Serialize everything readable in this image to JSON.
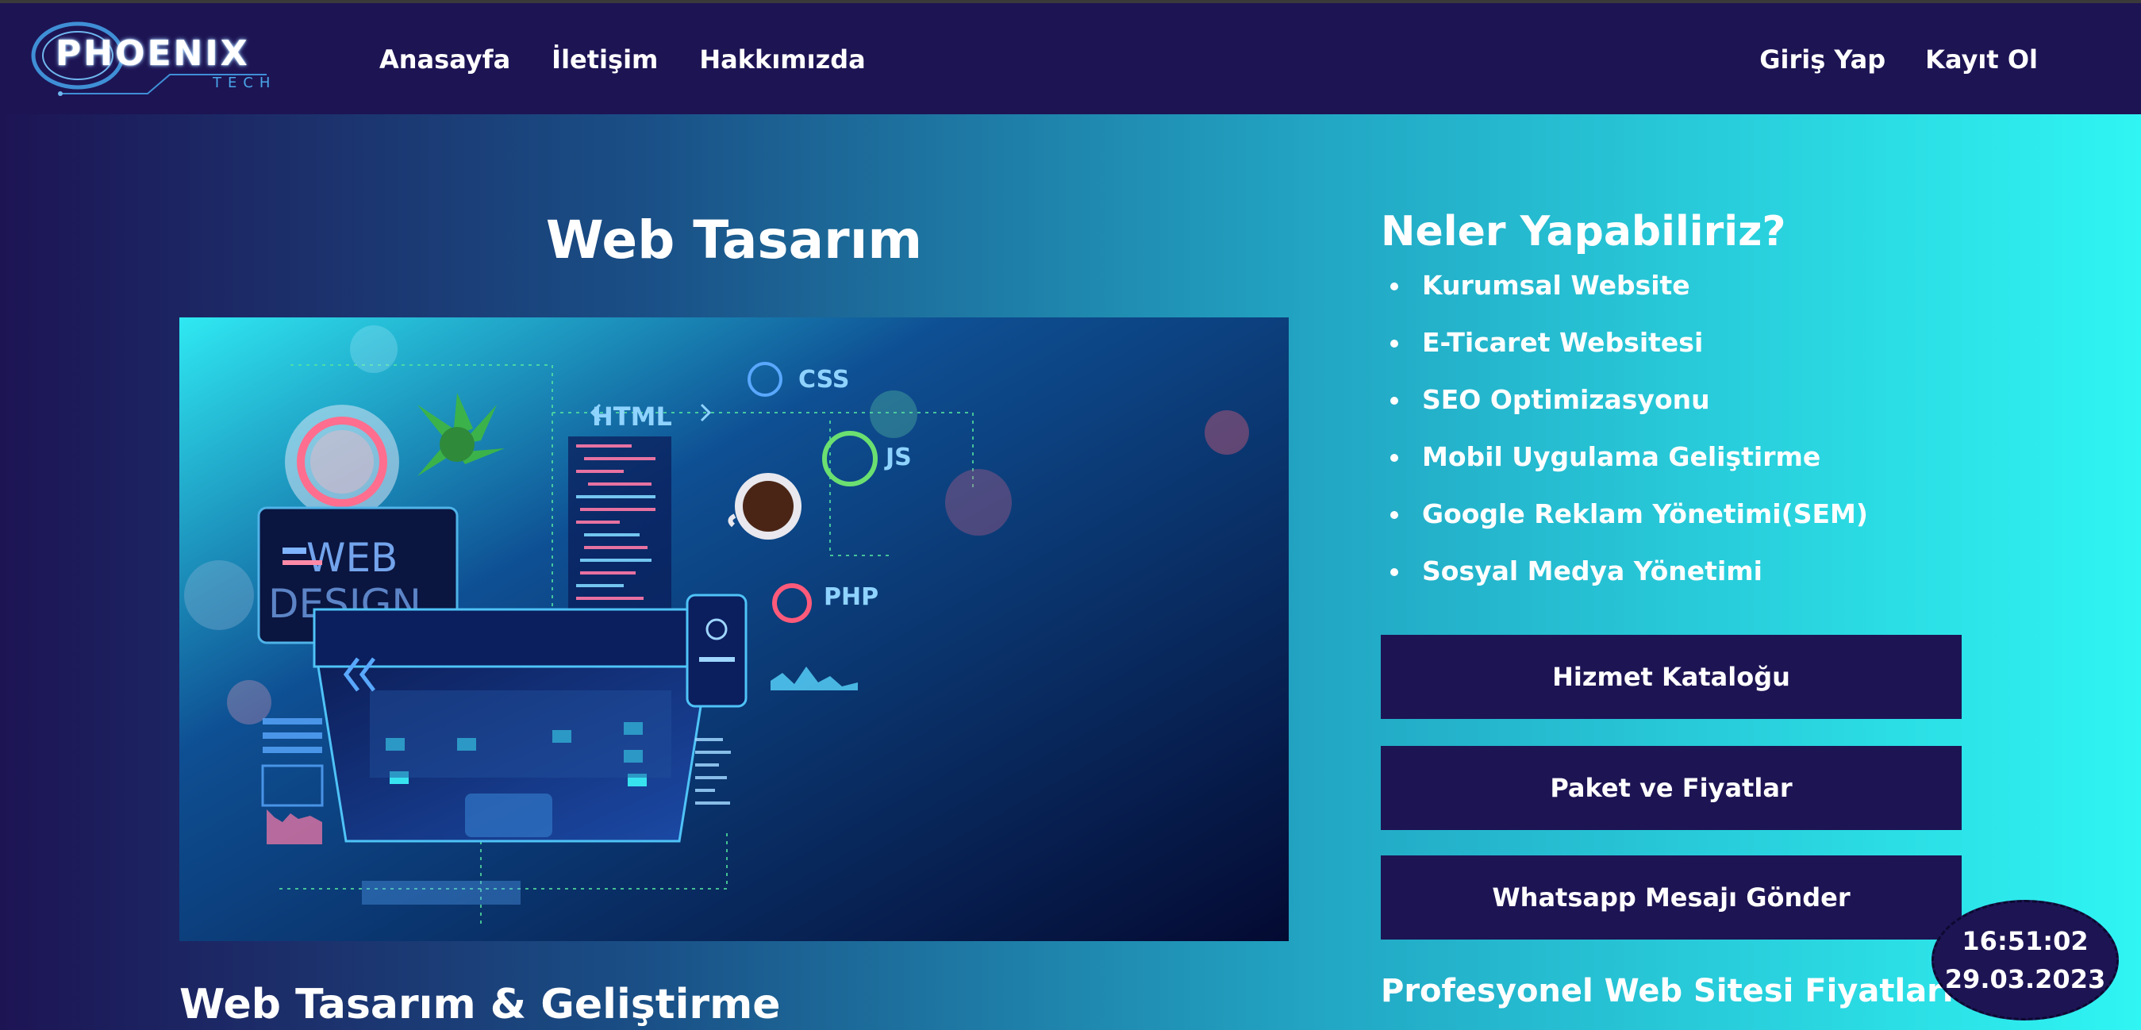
{
  "header": {
    "logo": {
      "word": "PHOENIX",
      "sub": "TECH"
    },
    "nav_left": [
      "Anasayfa",
      "İletişim",
      "Hakkımızda"
    ],
    "nav_right": [
      "Giriş Yap",
      "Kayıt Ol"
    ]
  },
  "hero": {
    "title": "Web Tasarım",
    "subtitle": "Web Tasarım & Geliştirme",
    "image": {
      "labels": [
        "WEB",
        "DESIGN",
        "HTML",
        "CSS",
        "JS",
        "PHP"
      ]
    }
  },
  "services": {
    "title": "Neler Yapabiliriz?",
    "items": [
      "Kurumsal Website",
      "E-Ticaret Websitesi",
      "SEO Optimizasyonu",
      "Mobil Uygulama Geliştirme",
      "Google Reklam Yönetimi(SEM)",
      "Sosyal Medya Yönetimi"
    ]
  },
  "actions": {
    "catalog": "Hizmet Kataloğu",
    "packages": "Paket ve Fiyatlar",
    "whatsapp": "Whatsapp Mesajı Gönder"
  },
  "prices_title": "Profesyonel Web Sitesi Fiyatları",
  "clock": {
    "time": "16:51:02",
    "date": "29.03.2023"
  },
  "colors": {
    "navy": "#1d1454",
    "cyan": "#2ff5f3",
    "white": "#ffffff"
  }
}
